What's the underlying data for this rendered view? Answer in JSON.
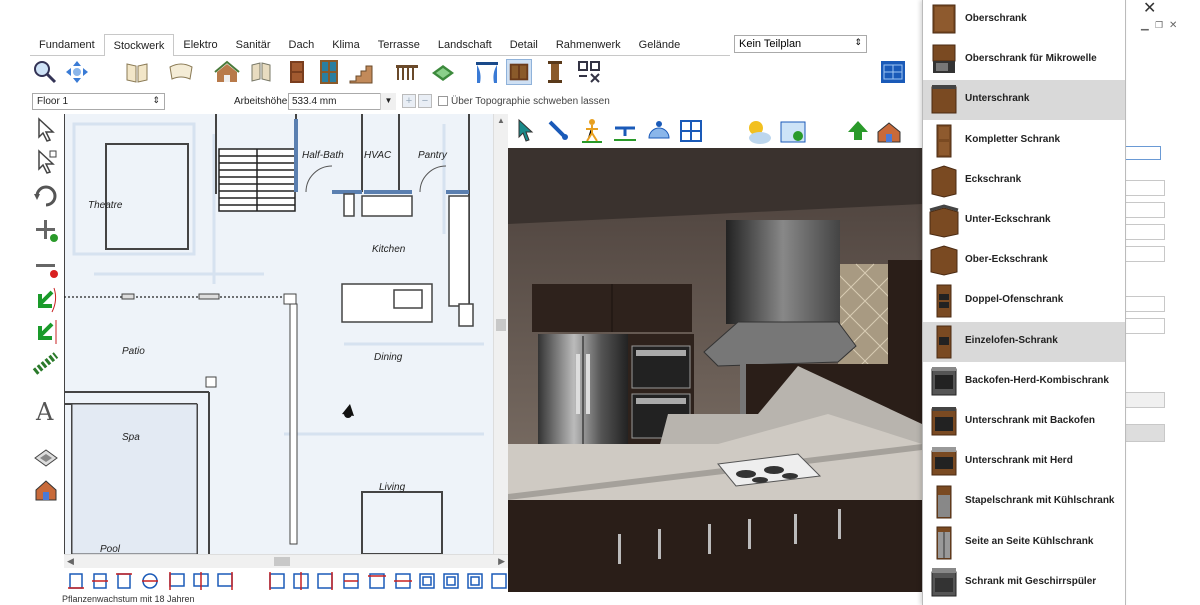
{
  "tabs": [
    {
      "label": "Fundament",
      "active": false
    },
    {
      "label": "Stockwerk",
      "active": true
    },
    {
      "label": "Elektro",
      "active": false
    },
    {
      "label": "Sanitär",
      "active": false
    },
    {
      "label": "Dach",
      "active": false
    },
    {
      "label": "Klima",
      "active": false
    },
    {
      "label": "Terrasse",
      "active": false
    },
    {
      "label": "Landschaft",
      "active": false
    },
    {
      "label": "Detail",
      "active": false
    },
    {
      "label": "Rahmenwerk",
      "active": false
    },
    {
      "label": "Gelände",
      "active": false
    }
  ],
  "plan_select": {
    "value": "Kein Teilplan"
  },
  "floorbar": {
    "floor": "Floor 1",
    "arbeitshoehe_label": "Arbeitshöhe:",
    "arbeitshoehe_value": "533.4 mm",
    "topo_label": "Über Topographie schweben lassen"
  },
  "plan": {
    "rooms": {
      "theatre": "Theatre",
      "half_bath": "Half-Bath",
      "hvac": "HVAC",
      "pantry": "Pantry",
      "kitchen": "Kitchen",
      "patio": "Patio",
      "dining": "Dining",
      "spa": "Spa",
      "living": "Living",
      "pool": "Pool"
    }
  },
  "status": {
    "text": "Pflanzenwachstum mit 18 Jahren"
  },
  "catalog": {
    "items": [
      {
        "label": "Oberschrank",
        "highlight": false
      },
      {
        "label": "Oberschrank für Mikrowelle",
        "highlight": false
      },
      {
        "label": "Unterschrank",
        "highlight": true
      },
      {
        "label": "Kompletter Schrank",
        "highlight": false
      },
      {
        "label": "Eckschrank",
        "highlight": false
      },
      {
        "label": "Unter-Eckschrank",
        "highlight": false
      },
      {
        "label": "Ober-Eckschrank",
        "highlight": false
      },
      {
        "label": "Doppel-Ofenschrank",
        "highlight": false
      },
      {
        "label": "Einzelofen-Schrank",
        "highlight": true
      },
      {
        "label": "Backofen-Herd-Kombischrank",
        "highlight": false
      },
      {
        "label": "Unterschrank mit Backofen",
        "highlight": false
      },
      {
        "label": "Unterschrank mit Herd",
        "highlight": false
      },
      {
        "label": "Stapelschrank mit Kühlschrank",
        "highlight": false
      },
      {
        "label": "Seite an Seite Kühlschrank",
        "highlight": false
      },
      {
        "label": "Schrank mit Geschirrspüler",
        "highlight": false
      }
    ]
  },
  "window": {
    "close_glyph": "✕"
  }
}
